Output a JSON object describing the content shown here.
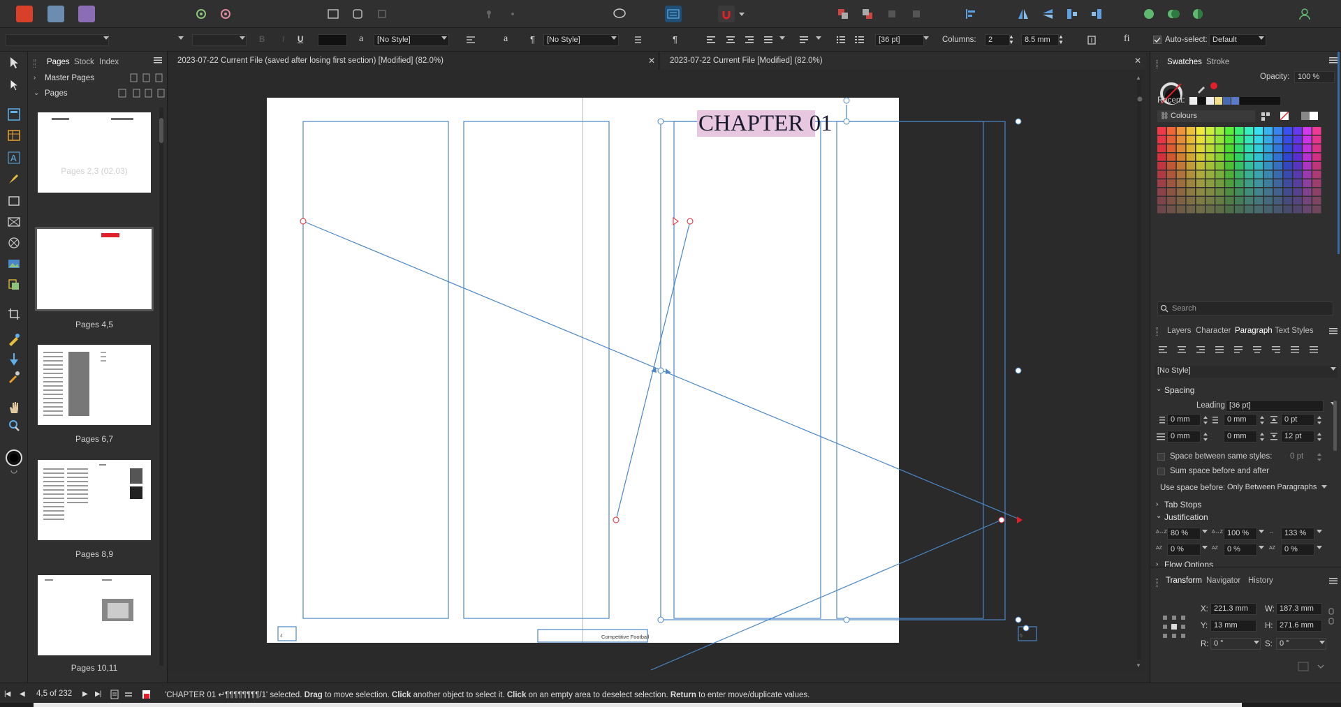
{
  "context_bar": {
    "char_style": "[No Style]",
    "para_style": "[No Style]",
    "leading": "[36 pt]",
    "columns_label": "Columns:",
    "columns_value": "2",
    "gutter_value": "8.5 mm",
    "ligature_glyph": "fi",
    "autoselect_label": "Auto-select:",
    "autoselect_value": "Default"
  },
  "pages_panel": {
    "tabs": [
      "Pages",
      "Stock",
      "Index"
    ],
    "master_pages_label": "Master Pages",
    "pages_label": "Pages",
    "thumbnails": [
      {
        "label": "Pages 2,3 (02,03)"
      },
      {
        "label": "Pages 4,5",
        "selected": true
      },
      {
        "label": "Pages 6,7"
      },
      {
        "label": "Pages 8,9"
      },
      {
        "label": "Pages 10,11"
      }
    ]
  },
  "doc_tabs": [
    {
      "title": "2023-07-22 Current File (saved after losing first section) [Modified] (82.0%)"
    },
    {
      "title": "2023-07-22 Current File [Modified] (82.0%)"
    }
  ],
  "document": {
    "chapter_title": "CHAPTER 01",
    "footer_text": "Competitive Football",
    "left_page_number": "4",
    "right_page_number": "5"
  },
  "right_panel": {
    "top_tabs": [
      "Swatches",
      "Stroke"
    ],
    "opacity_label": "Opacity:",
    "opacity_value": "100 %",
    "recent_label": "Recent:",
    "palette_name": "Colours",
    "search_placeholder": "Search",
    "mid_tabs": [
      "Layers",
      "Character",
      "Paragraph",
      "Text Styles"
    ],
    "paragraph_style": "[No Style]",
    "spacing_label": "Spacing",
    "leading_label": "Leading:",
    "leading_value": "[36 pt]",
    "indent_left": "0 mm",
    "indent_right": "0 mm",
    "space_before": "0 pt",
    "first_line": "0 mm",
    "last_line": "0 mm",
    "space_after": "12 pt",
    "same_styles_label": "Space between same styles:",
    "same_styles_value": "0 pt",
    "sum_space_label": "Sum space before and after",
    "use_space_label": "Use space before:",
    "use_space_value": "Only Between Paragraphs",
    "tab_stops_label": "Tab Stops",
    "justification_label": "Justification",
    "word_min": "80 %",
    "word_desired": "100 %",
    "word_max": "133 %",
    "letter_min": "0 %",
    "letter_desired": "0 %",
    "letter_max": "0 %",
    "flow_options_label": "Flow Options",
    "bottom_tabs": [
      "Transform",
      "Navigator",
      "History"
    ],
    "x_label": "X:",
    "x_value": "221.3 mm",
    "y_label": "Y:",
    "y_value": "13 mm",
    "w_label": "W:",
    "w_value": "187.3 mm",
    "h_label": "H:",
    "h_value": "271.6 mm",
    "r_label": "R:",
    "r_value": "0 °",
    "s_label": "S:",
    "s_value": "0 °"
  },
  "status_bar": {
    "page_position": "4,5 of 232",
    "message_part1": "'CHAPTER 01 ↵¶¶¶¶¶¶¶¶/1' selected.",
    "drag_word": "Drag",
    "message_part2": "to move selection.",
    "click_word": "Click",
    "message_part3": "another object to select it.",
    "click_word2": "Click",
    "message_part4": "on an empty area to deselect selection.",
    "return_word": "Return",
    "message_part5": "to enter move/duplicate values."
  },
  "colors": {
    "frame_blue": "#4a86c8",
    "chapter_highlight": "#e8c8e0",
    "accent_red": "#e0202a"
  }
}
